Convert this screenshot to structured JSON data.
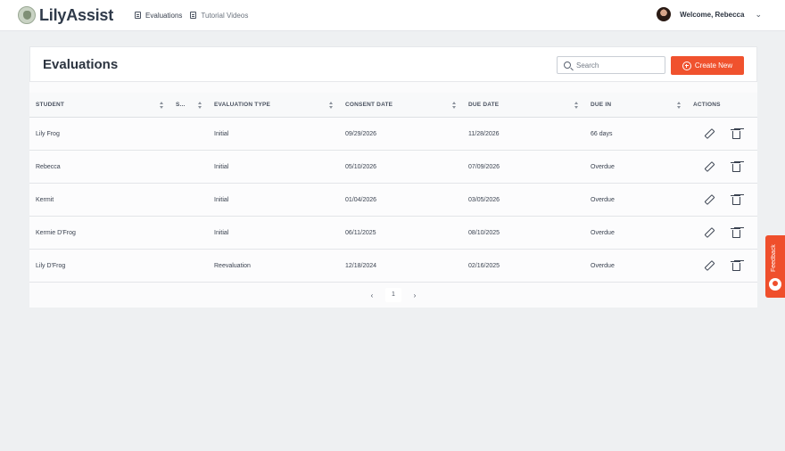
{
  "app": {
    "brand": "LilyAssist"
  },
  "nav": {
    "items": [
      {
        "label": "Evaluations",
        "icon": "document-icon"
      },
      {
        "label": "Tutorial Videos",
        "icon": "document-icon"
      }
    ]
  },
  "user": {
    "welcome": "Welcome, Rebecca",
    "menu_icon": "chevron-down-icon"
  },
  "page": {
    "title": "Evaluations",
    "search_placeholder": "Search",
    "create_label": "Create New"
  },
  "table": {
    "columns": [
      "STUDENT",
      "S...",
      "EVALUATION TYPE",
      "CONSENT DATE",
      "DUE DATE",
      "DUE IN",
      "ACTIONS"
    ],
    "rows": [
      {
        "student": "Lily Frog",
        "s": "",
        "type": "Initial",
        "consent": "09/29/2026",
        "due": "11/28/2026",
        "due_in": "66 days"
      },
      {
        "student": "Rebecca",
        "s": "",
        "type": "Initial",
        "consent": "05/10/2026",
        "due": "07/09/2026",
        "due_in": "Overdue"
      },
      {
        "student": "Kermit",
        "s": "",
        "type": "Initial",
        "consent": "01/04/2026",
        "due": "03/05/2026",
        "due_in": "Overdue"
      },
      {
        "student": "Kermie D'Frog",
        "s": "",
        "type": "Initial",
        "consent": "06/11/2025",
        "due": "08/10/2025",
        "due_in": "Overdue"
      },
      {
        "student": "Lily D'Frog",
        "s": "",
        "type": "Reevaluation",
        "consent": "12/18/2024",
        "due": "02/16/2025",
        "due_in": "Overdue"
      }
    ]
  },
  "pagination": {
    "prev": "‹",
    "current": "1",
    "next": "›"
  },
  "feedback": {
    "label": "Feedback"
  },
  "colors": {
    "accent": "#f0522e"
  }
}
